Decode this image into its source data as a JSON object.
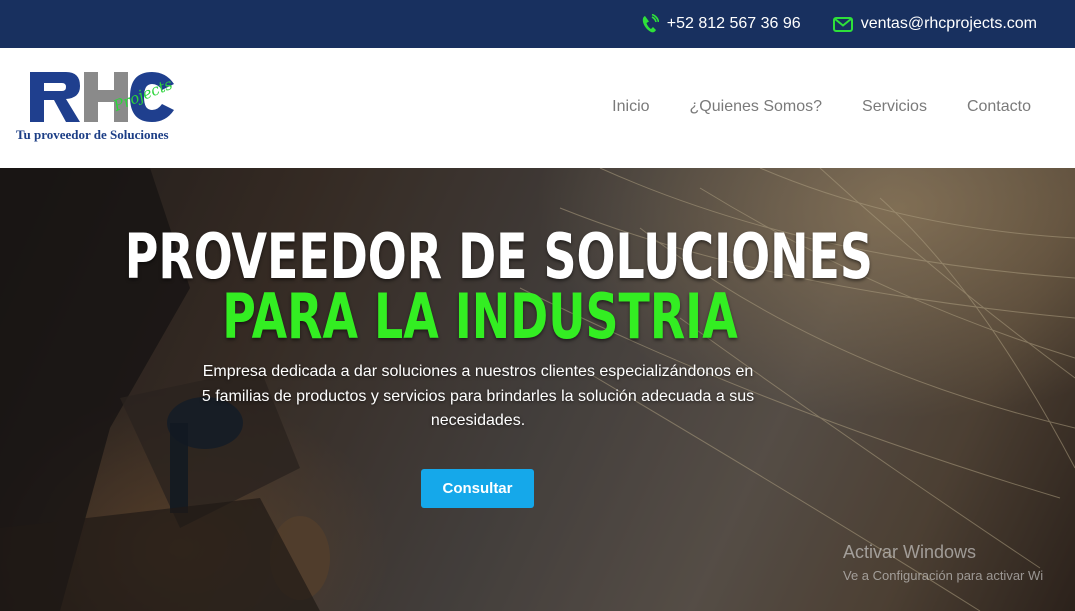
{
  "topbar": {
    "phone": "+52 812 567 36 96",
    "phone_icon": "phone-icon",
    "email": "ventas@rhcprojects.com",
    "email_icon": "envelope-icon",
    "background": "#18305f",
    "icon_color": "#2ee03a"
  },
  "logo": {
    "mark": "RHC",
    "script": "Projects",
    "tagline": "Tu proveedor de Soluciones"
  },
  "nav": {
    "items": [
      {
        "label": "Inicio"
      },
      {
        "label": "¿Quienes Somos?"
      },
      {
        "label": "Servicios"
      },
      {
        "label": "Contacto"
      }
    ]
  },
  "hero": {
    "title_line1": "PROVEEDOR DE SOLUCIONES",
    "title_line2": "PARA LA INDUSTRIA",
    "description": "Empresa dedicada a dar soluciones a nuestros clientes especializándonos en 5 familias de productos y servicios para brindarles la solución adecuada a sus necesidades.",
    "button_label": "Consultar",
    "accent_green": "#33ee22",
    "button_color": "#15a8ea"
  },
  "watermark": {
    "title": "Activar Windows",
    "subtitle": "Ve a Configuración para activar Wi"
  }
}
